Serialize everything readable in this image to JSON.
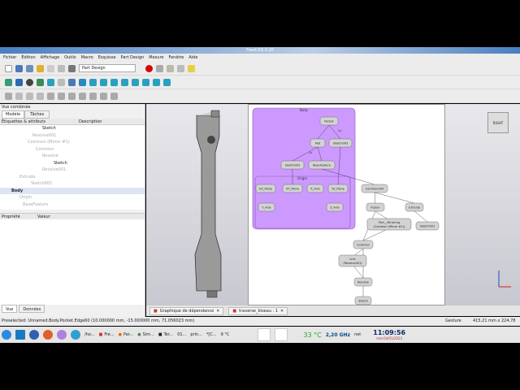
{
  "window": {
    "title": "FreeCAD 0.20"
  },
  "menu": [
    "Fichier",
    "Édition",
    "Affichage",
    "Outils",
    "Macro",
    "Esquisse",
    "Part Design",
    "Mesure",
    "Fenêtre",
    "Aide"
  ],
  "toolbar": {
    "workbench": "Part Design"
  },
  "combo": {
    "title": "Vue combinée",
    "tabs": [
      "Modèle",
      "Tâches"
    ],
    "columns": [
      "Étiquettes & attributs",
      "Description"
    ],
    "tree": [
      {
        "label": "Sketch",
        "dim": false,
        "indent": 52
      },
      {
        "label": "Revolve001",
        "dim": true,
        "indent": 40
      },
      {
        "label": "Common (Mirror #1)",
        "dim": true,
        "indent": 34
      },
      {
        "label": "Common",
        "dim": true,
        "indent": 44
      },
      {
        "label": "Revolve",
        "dim": true,
        "indent": 52
      },
      {
        "label": "Sketch",
        "dim": false,
        "indent": 66
      },
      {
        "label": "Revolve001",
        "dim": true,
        "indent": 52
      },
      {
        "label": "Extrude",
        "dim": true,
        "indent": 24
      },
      {
        "label": "Sketch001",
        "dim": true,
        "indent": 38
      },
      {
        "label": "Body",
        "dim": false,
        "indent": 14
      },
      {
        "label": "Origin",
        "dim": true,
        "indent": 24
      },
      {
        "label": "BaseFeature",
        "dim": true,
        "indent": 28
      }
    ],
    "prop_columns": [
      "Propriété",
      "Valeur"
    ],
    "bottom_tabs": [
      "Vue",
      "Données"
    ]
  },
  "graph": {
    "clusters": [
      "Body",
      "Origin"
    ],
    "nodes": [
      "Pocket",
      "Pad",
      "Sketch003",
      "Sketch002",
      "BaseFeature",
      "XZ_Plane",
      "XY_Plane",
      "X_Axis",
      "YZ_Plane",
      "Y_Axis",
      "Z_Axis",
      "Common004",
      "Fusion",
      "Extrude",
      "Part__Mirroring",
      "(Common (Mirror #1))",
      "Sketch001",
      "Common",
      "Link",
      "(Revolve001)",
      "Revolve",
      "Sketch"
    ],
    "edge_labels": [
      "2x",
      "2x"
    ]
  },
  "doc_tabs": [
    "Graphique de dépendance",
    "traverse_biseau : 1"
  ],
  "navcube": "RIGHT",
  "status": {
    "text": "Preselected: Unnamed.Body.Pocket.Edge60 (10.000000 mm, -15.000000 mm, 71.056023 mm)",
    "nav": "Gesture",
    "dims": "415,21 mm x 224,78 mm"
  },
  "taskbar": {
    "items": [
      "/ho...",
      "Fre...",
      "Par...",
      "Sim...",
      "Ter...",
      "01...",
      "prin...",
      "*[C..."
    ],
    "weather": "9 °C",
    "temp": "33 °C",
    "cpu": "2,20 GHz",
    "net": "net",
    "time": "11:09:56",
    "date": "mer.04/01/2023"
  }
}
